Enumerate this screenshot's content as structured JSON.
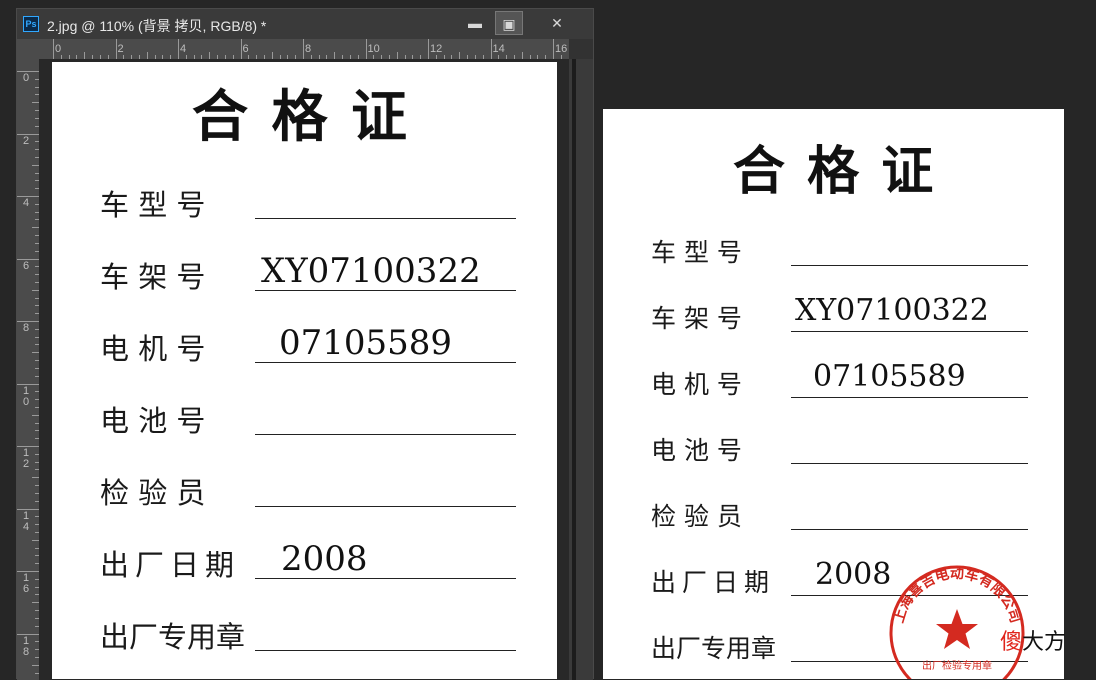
{
  "photoshop": {
    "app_icon": "Ps",
    "window_title": "2.jpg @ 110% (背景 拷贝, RGB/8) *",
    "window_controls": {
      "minimize": "▬",
      "maximize": "▣",
      "close": "✕"
    },
    "ruler_h_labels": [
      "0",
      "2",
      "4",
      "6",
      "8",
      "10",
      "12",
      "14",
      "16"
    ],
    "ruler_v_labels": [
      "0",
      "2",
      "4",
      "6",
      "8",
      "1\n0",
      "1\n2",
      "1\n4",
      "1\n6",
      "1\n8"
    ]
  },
  "certificate_left": {
    "title": "合 格 证",
    "rows": [
      {
        "label": "车 型 号",
        "value": ""
      },
      {
        "label": "车 架 号",
        "value": "XY07100322"
      },
      {
        "label": "电 机 号",
        "value": "07105589"
      },
      {
        "label": "电 池 号",
        "value": ""
      },
      {
        "label": "检 验 员",
        "value": ""
      },
      {
        "label": "出厂日期",
        "value": "2008"
      },
      {
        "label": "出厂专用章",
        "value": ""
      }
    ]
  },
  "certificate_right": {
    "title": "合 格 证",
    "rows": [
      {
        "label": "车 型 号",
        "value": ""
      },
      {
        "label": "车 架 号",
        "value": "XY07100322"
      },
      {
        "label": "电 机 号",
        "value": "07105589"
      },
      {
        "label": "电 池 号",
        "value": ""
      },
      {
        "label": "检 验 员",
        "value": ""
      },
      {
        "label": "出厂日期",
        "value": "2008"
      },
      {
        "label": "出厂专用章",
        "value": ""
      }
    ],
    "stamp": {
      "arc_text": "上海喜吉电动车有限公司",
      "bottom_text": "出厂检验专用章",
      "color": "#d42a20"
    }
  },
  "watermark": {
    "highlight": "傻",
    "rest": "大方",
    "highlight_color": "#e0241b"
  }
}
